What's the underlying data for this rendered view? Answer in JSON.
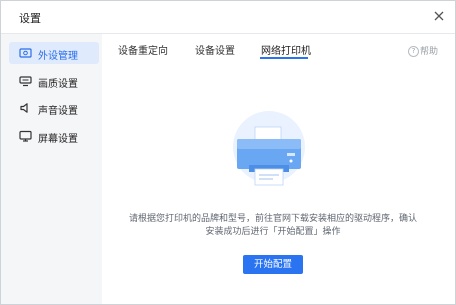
{
  "window": {
    "title": "设置"
  },
  "sidebar": {
    "items": [
      {
        "label": "外设管理",
        "icon": "peripheral-icon",
        "active": true
      },
      {
        "label": "画质设置",
        "icon": "display-quality-icon",
        "active": false
      },
      {
        "label": "声音设置",
        "icon": "speaker-icon",
        "active": false
      },
      {
        "label": "屏幕设置",
        "icon": "monitor-icon",
        "active": false
      }
    ]
  },
  "tabs": [
    {
      "label": "设备重定向",
      "active": false
    },
    {
      "label": "设备设置",
      "active": false
    },
    {
      "label": "网络打印机",
      "active": true
    }
  ],
  "help": {
    "label": "帮助",
    "icon": "question-circle-icon"
  },
  "main": {
    "illustration": "printer-illustration",
    "description_line1": "请根据您打印机的品牌和型号，前往官网下载安装相应的驱动程序，确认",
    "description_line2": "安装成功后进行「开始配置」操作",
    "button_label": "开始配置"
  },
  "colors": {
    "accent": "#2a74f2",
    "active_bg": "#dfeafd",
    "sidebar_bg": "#f5f6f8"
  }
}
